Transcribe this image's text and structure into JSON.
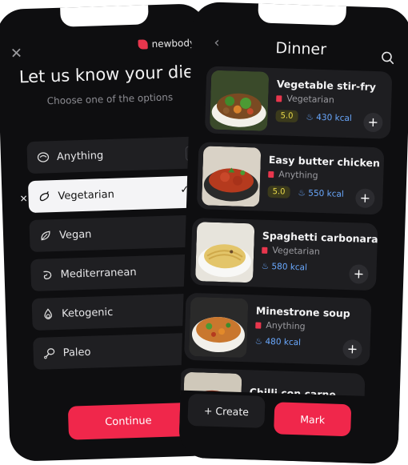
{
  "diet_screen": {
    "brand": "newbody",
    "title": "Let us know your diet",
    "subtitle": "Choose one of the options",
    "options": [
      {
        "label": "Anything",
        "icon": "plate-icon",
        "selected": false
      },
      {
        "label": "Vegetarian",
        "icon": "eggplant-icon",
        "selected": true
      },
      {
        "label": "Vegan",
        "icon": "leaf-icon",
        "selected": false
      },
      {
        "label": "Mediterranean",
        "icon": "shrimp-icon",
        "selected": false
      },
      {
        "label": "Ketogenic",
        "icon": "onion-icon",
        "selected": false
      },
      {
        "label": "Paleo",
        "icon": "drumstick-icon",
        "selected": false
      }
    ],
    "continue_label": "Continue"
  },
  "dinner_screen": {
    "title": "Dinner",
    "recipes": [
      {
        "name": "Vegetable stir-fry",
        "category": "Vegetarian",
        "rating": "5.0",
        "kcal": "430 kcal"
      },
      {
        "name": "Easy butter chicken",
        "category": "Anything",
        "rating": "5.0",
        "kcal": "550 kcal"
      },
      {
        "name": "Spaghetti carbonara",
        "category": "Vegetarian",
        "rating": "",
        "kcal": "580 kcal"
      },
      {
        "name": "Minestrone soup",
        "category": "Anything",
        "rating": "",
        "kcal": "480 kcal"
      },
      {
        "name": "Chilli con carne",
        "category": "",
        "rating": "",
        "kcal": ""
      }
    ],
    "create_label": "+ Create",
    "mark_label": "Mark"
  },
  "colors": {
    "accent": "#f0274b",
    "background": "#0e0e10",
    "card": "#1e1e21",
    "kcal": "#6aa9ff",
    "rating": "#e8d84a"
  }
}
